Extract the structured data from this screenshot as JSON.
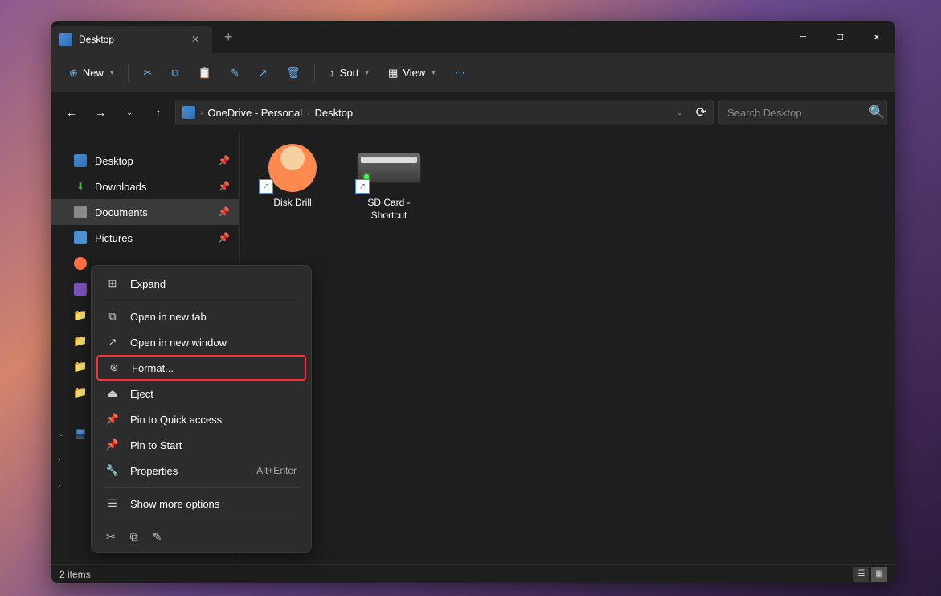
{
  "tab": {
    "title": "Desktop"
  },
  "toolbar": {
    "new": "New",
    "sort": "Sort",
    "view": "View"
  },
  "breadcrumb": {
    "part1": "OneDrive - Personal",
    "part2": "Desktop"
  },
  "search": {
    "placeholder": "Search Desktop"
  },
  "sidebar": {
    "items": [
      {
        "label": "Desktop",
        "pinned": true
      },
      {
        "label": "Downloads",
        "pinned": true
      },
      {
        "label": "Documents",
        "pinned": true
      },
      {
        "label": "Pictures",
        "pinned": true
      }
    ]
  },
  "files": [
    {
      "name": "Disk Drill"
    },
    {
      "name": "SD Card - Shortcut"
    }
  ],
  "context_menu": {
    "items": [
      {
        "label": "Expand"
      },
      {
        "label": "Open in new tab"
      },
      {
        "label": "Open in new window"
      },
      {
        "label": "Format..."
      },
      {
        "label": "Eject"
      },
      {
        "label": "Pin to Quick access"
      },
      {
        "label": "Pin to Start"
      },
      {
        "label": "Properties",
        "shortcut": "Alt+Enter"
      },
      {
        "label": "Show more options"
      }
    ]
  },
  "status": {
    "items": "2 items"
  }
}
